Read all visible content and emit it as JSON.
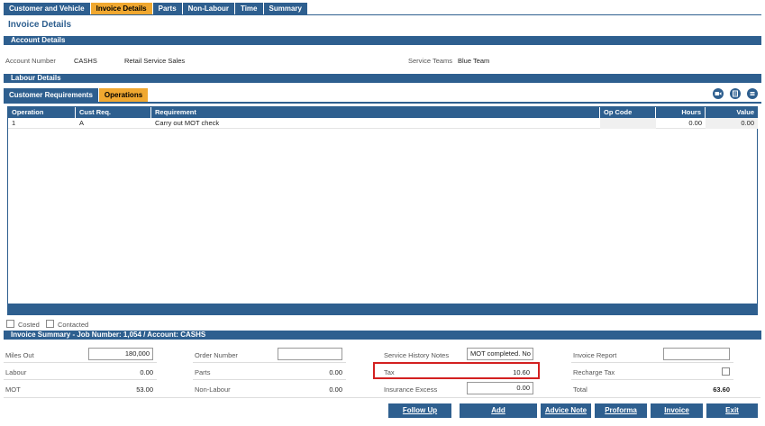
{
  "top_tabs": [
    "Customer and Vehicle",
    "Invoice Details",
    "Parts",
    "Non-Labour",
    "Time",
    "Summary"
  ],
  "page_title": "Invoice Details",
  "account_details": {
    "header": "Account Details",
    "account_number_label": "Account Number",
    "account_number": "CASHS",
    "account_name": "Retail Service Sales",
    "service_teams_label": "Service Teams",
    "service_teams": "Blue Team"
  },
  "labour_details": {
    "header": "Labour Details",
    "sub_tabs": [
      "Customer Requirements",
      "Operations"
    ],
    "icons": [
      "video-camera-icon",
      "export-icon",
      "list-icon"
    ],
    "columns": [
      "Operation",
      "Cust Req.",
      "Requirement",
      "Op Code",
      "Hours",
      "Value"
    ],
    "rows": [
      {
        "operation": "1",
        "cust_req": "A",
        "requirement": "Carry out MOT check",
        "op_code": "",
        "hours": "0.00",
        "value": "0.00"
      }
    ],
    "costed_label": "Costed",
    "contacted_label": "Contacted"
  },
  "invoice_summary": {
    "header": "Invoice Summary - Job Number: 1,054 / Account: CASHS",
    "miles_out_label": "Miles Out",
    "miles_out": "180,000",
    "order_number_label": "Order Number",
    "order_number": "",
    "service_history_label": "Service History Notes",
    "service_history": "MOT completed. No",
    "invoice_report_label": "Invoice Report",
    "invoice_report": "",
    "labour_label": "Labour",
    "labour": "0.00",
    "parts_label": "Parts",
    "parts": "0.00",
    "tax_label": "Tax",
    "tax": "10.60",
    "recharge_tax_label": "Recharge Tax",
    "mot_label": "MOT",
    "mot": "53.00",
    "non_labour_label": "Non-Labour",
    "non_labour": "0.00",
    "insurance_excess_label": "Insurance Excess",
    "insurance_excess": "0.00",
    "total_label": "Total",
    "total": "63.60"
  },
  "buttons": {
    "follow_up": "Follow Up",
    "add": "Add",
    "advice_note": "Advice Note",
    "proforma": "Proforma",
    "invoice": "Invoice",
    "exit": "Exit"
  },
  "colors": {
    "primary": "#2e5f8f",
    "active_tab": "#f0a830",
    "highlight": "#d32020"
  }
}
